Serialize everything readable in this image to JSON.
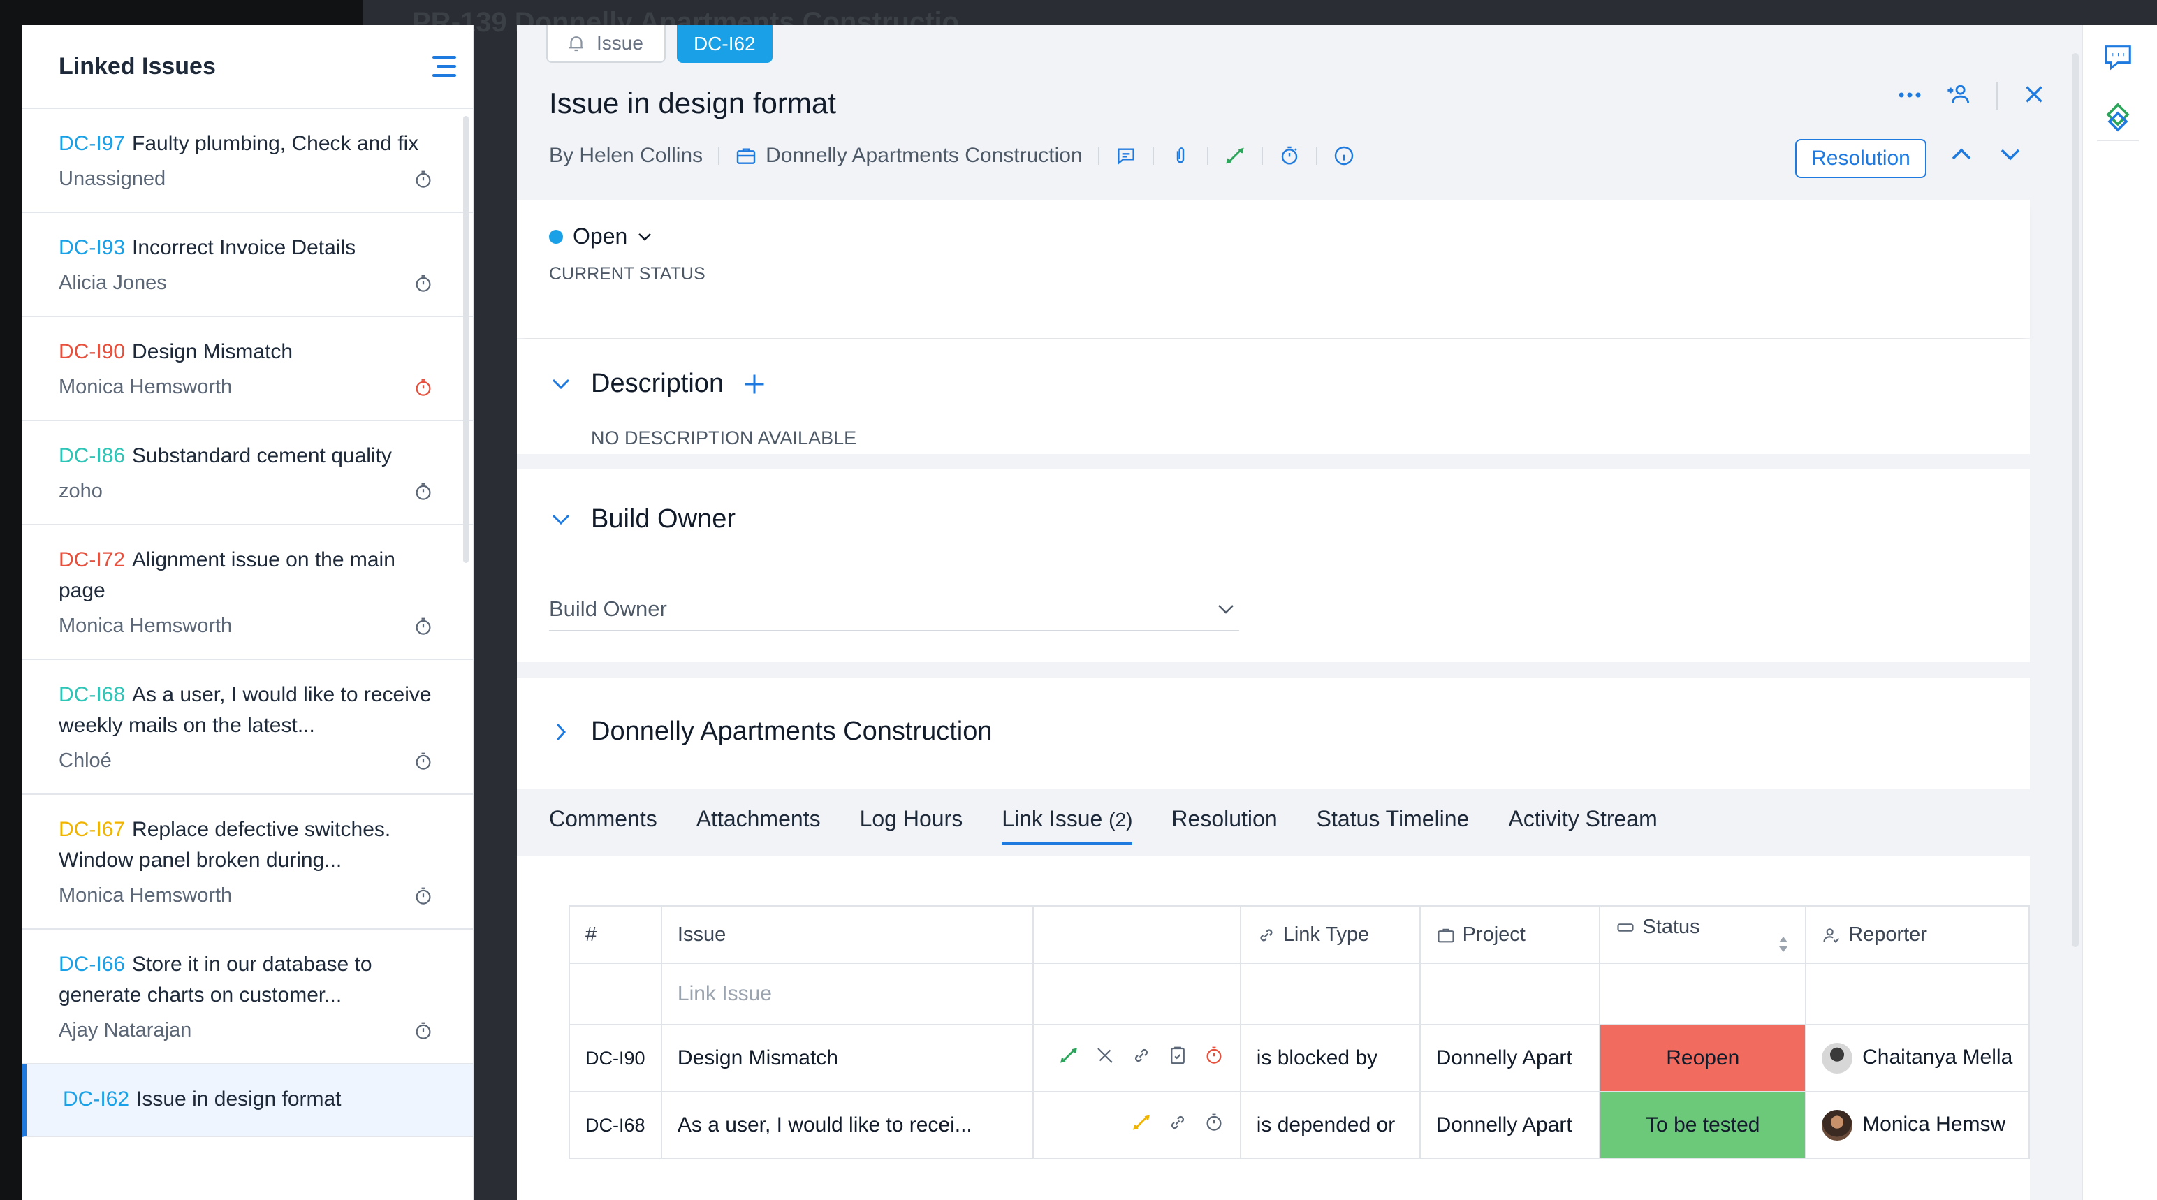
{
  "backdrop": {
    "title_text": "PR-139 Donnelly Apartments Constructio"
  },
  "left_panel": {
    "title": "Linked Issues",
    "items": [
      {
        "id": "DC-I97",
        "id_color": "#1aa0e6",
        "title": "Faulty plumbing, Check and fix",
        "assignee": "Unassigned",
        "timer_color": "#5b6676"
      },
      {
        "id": "DC-I93",
        "id_color": "#1aa0e6",
        "title": "Incorrect Invoice Details",
        "assignee": "Alicia Jones",
        "timer_color": "#5b6676"
      },
      {
        "id": "DC-I90",
        "id_color": "#e6503c",
        "title": "Design Mismatch",
        "assignee": "Monica Hemsworth",
        "timer_color": "#e6503c"
      },
      {
        "id": "DC-I86",
        "id_color": "#2ec4b6",
        "title": "Substandard cement quality",
        "assignee": "zoho",
        "timer_color": "#5b6676"
      },
      {
        "id": "DC-I72",
        "id_color": "#e6503c",
        "title": "Alignment issue on the main page",
        "assignee": "Monica Hemsworth",
        "timer_color": "#5b6676"
      },
      {
        "id": "DC-I68",
        "id_color": "#2ec4b6",
        "title": "As a user, I would like to receive weekly mails on the latest...",
        "assignee": "Chloé",
        "timer_color": "#5b6676"
      },
      {
        "id": "DC-I67",
        "id_color": "#f0b400",
        "title": "Replace defective switches. Window panel broken during...",
        "assignee": "Monica Hemsworth",
        "timer_color": "#5b6676"
      },
      {
        "id": "DC-I66",
        "id_color": "#1aa0e6",
        "title": "Store it in our database to generate charts on customer...",
        "assignee": "Ajay Natarajan",
        "timer_color": "#5b6676"
      },
      {
        "id": "DC-I62",
        "id_color": "#1aa0e6",
        "title": "Issue in design format",
        "assignee": "",
        "timer_color": "#5b6676"
      }
    ]
  },
  "issue": {
    "type_label": "Issue",
    "id": "DC-I62",
    "title": "Issue in design format",
    "author": "By Helen Collins",
    "project": "Donnelly Apartments Construction",
    "resolution_button": "Resolution"
  },
  "status": {
    "value": "Open",
    "caption": "CURRENT STATUS",
    "dot_color": "#1aa0e6"
  },
  "description": {
    "heading": "Description",
    "empty_text": "NO DESCRIPTION AVAILABLE"
  },
  "build_owner": {
    "heading": "Build Owner",
    "field_value": "Build Owner"
  },
  "project_section": {
    "heading": "Donnelly Apartments Construction"
  },
  "tabs": [
    {
      "label": "Comments"
    },
    {
      "label": "Attachments"
    },
    {
      "label": "Log Hours"
    },
    {
      "label": "Link Issue",
      "count": "(2)",
      "active": true
    },
    {
      "label": "Resolution"
    },
    {
      "label": "Status Timeline"
    },
    {
      "label": "Activity Stream"
    }
  ],
  "link_table": {
    "headers": {
      "num": "#",
      "issue": "Issue",
      "link_type": "Link Type",
      "project": "Project",
      "status": "Status",
      "reporter": "Reporter"
    },
    "placeholder": "Link Issue",
    "rows": [
      {
        "id": "DC-I90",
        "issue": "Design Mismatch",
        "link_type": "is blocked by",
        "project": "Donnelly Apart",
        "status": "Reopen",
        "status_color": "#f26b5f",
        "reporter": "Chaitanya Mella"
      },
      {
        "id": "DC-I68",
        "issue": "As a user, I would like to recei...",
        "link_type": "is depended or",
        "project": "Donnelly Apart",
        "status": "To be tested",
        "status_color": "#6cc97a",
        "reporter": "Monica Hemsw"
      }
    ]
  },
  "colors": {
    "accent": "#1f7ae0",
    "brand_blue": "#1aa0e6"
  }
}
